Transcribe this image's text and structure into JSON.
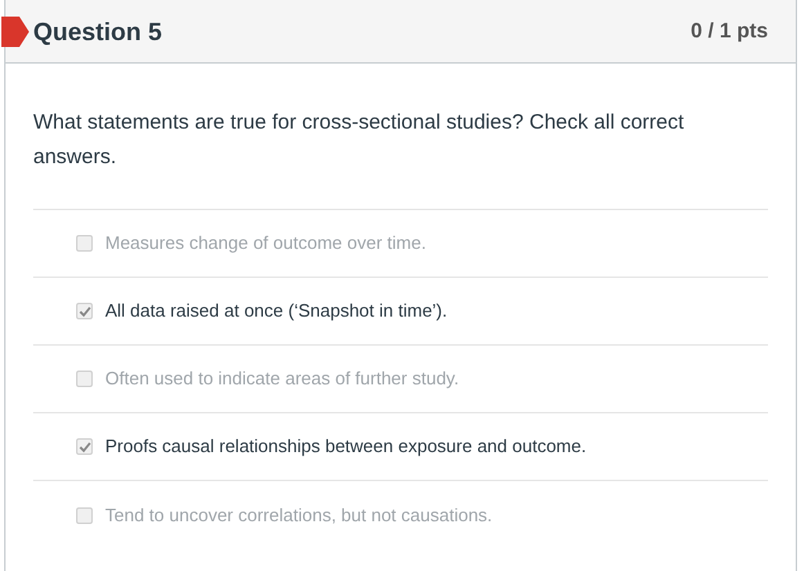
{
  "question": {
    "title": "Question 5",
    "points": "0 / 1 pts",
    "incorrect": true,
    "text": "What statements are true for cross-sectional studies? Check all correct answers."
  },
  "answers": [
    {
      "label": "Measures change of outcome over time.",
      "checked": false
    },
    {
      "label": "All data raised at once (‘Snapshot in time’).",
      "checked": true
    },
    {
      "label": "Often used to indicate areas of further study.",
      "checked": false
    },
    {
      "label": "Proofs causal relationships between exposure and outcome.",
      "checked": true
    },
    {
      "label": "Tend to uncover correlations, but not causations.",
      "checked": false
    }
  ]
}
